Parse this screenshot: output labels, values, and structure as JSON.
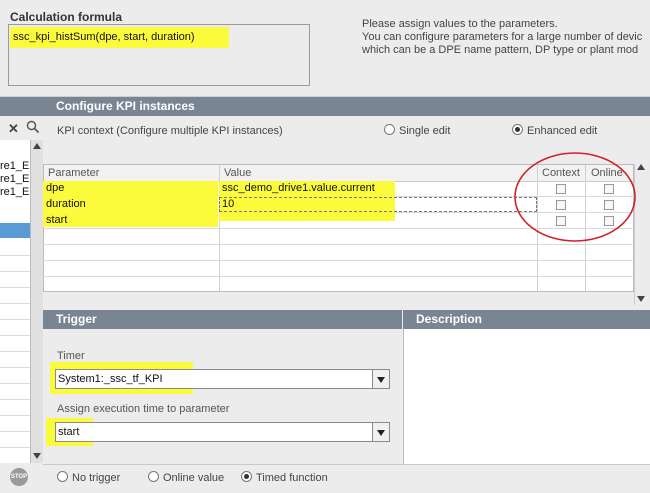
{
  "formula": {
    "title": "Calculation formula",
    "value": "ssc_kpi_histSum(dpe, start, duration)"
  },
  "info": {
    "line1": "Please assign values to the parameters.",
    "line2": "You can configure parameters for a large number of devic",
    "line3": "which can be a DPE name pattern, DP type or plant mod"
  },
  "left_list": {
    "items": [
      "re1_E",
      "re1_E",
      "re1_E"
    ]
  },
  "configure": {
    "title": "Configure KPI instances",
    "context_label": "KPI context (Configure multiple KPI instances)",
    "single_edit": "Single edit",
    "enhanced_edit": "Enhanced edit",
    "columns": {
      "parameter": "Parameter",
      "value": "Value",
      "context": "Context",
      "online": "Online"
    },
    "rows": [
      {
        "parameter": "dpe",
        "value": "ssc_demo_drive1.value.current"
      },
      {
        "parameter": "duration",
        "value": "10"
      },
      {
        "parameter": "start",
        "value": ""
      }
    ]
  },
  "trigger": {
    "title": "Trigger",
    "timer_label": "Timer",
    "timer_value": "System1:_ssc_tf_KPI",
    "assign_label": "Assign execution time to parameter",
    "assign_value": "start",
    "options": [
      "No trigger",
      "Online value",
      "Timed function"
    ],
    "selected": "Timed function"
  },
  "description": {
    "title": "Description"
  },
  "stop_icon_text": "STOP",
  "colors": {
    "highlight": "#fbfb3c",
    "header": "#7a8594",
    "annotation": "#d0212b"
  }
}
